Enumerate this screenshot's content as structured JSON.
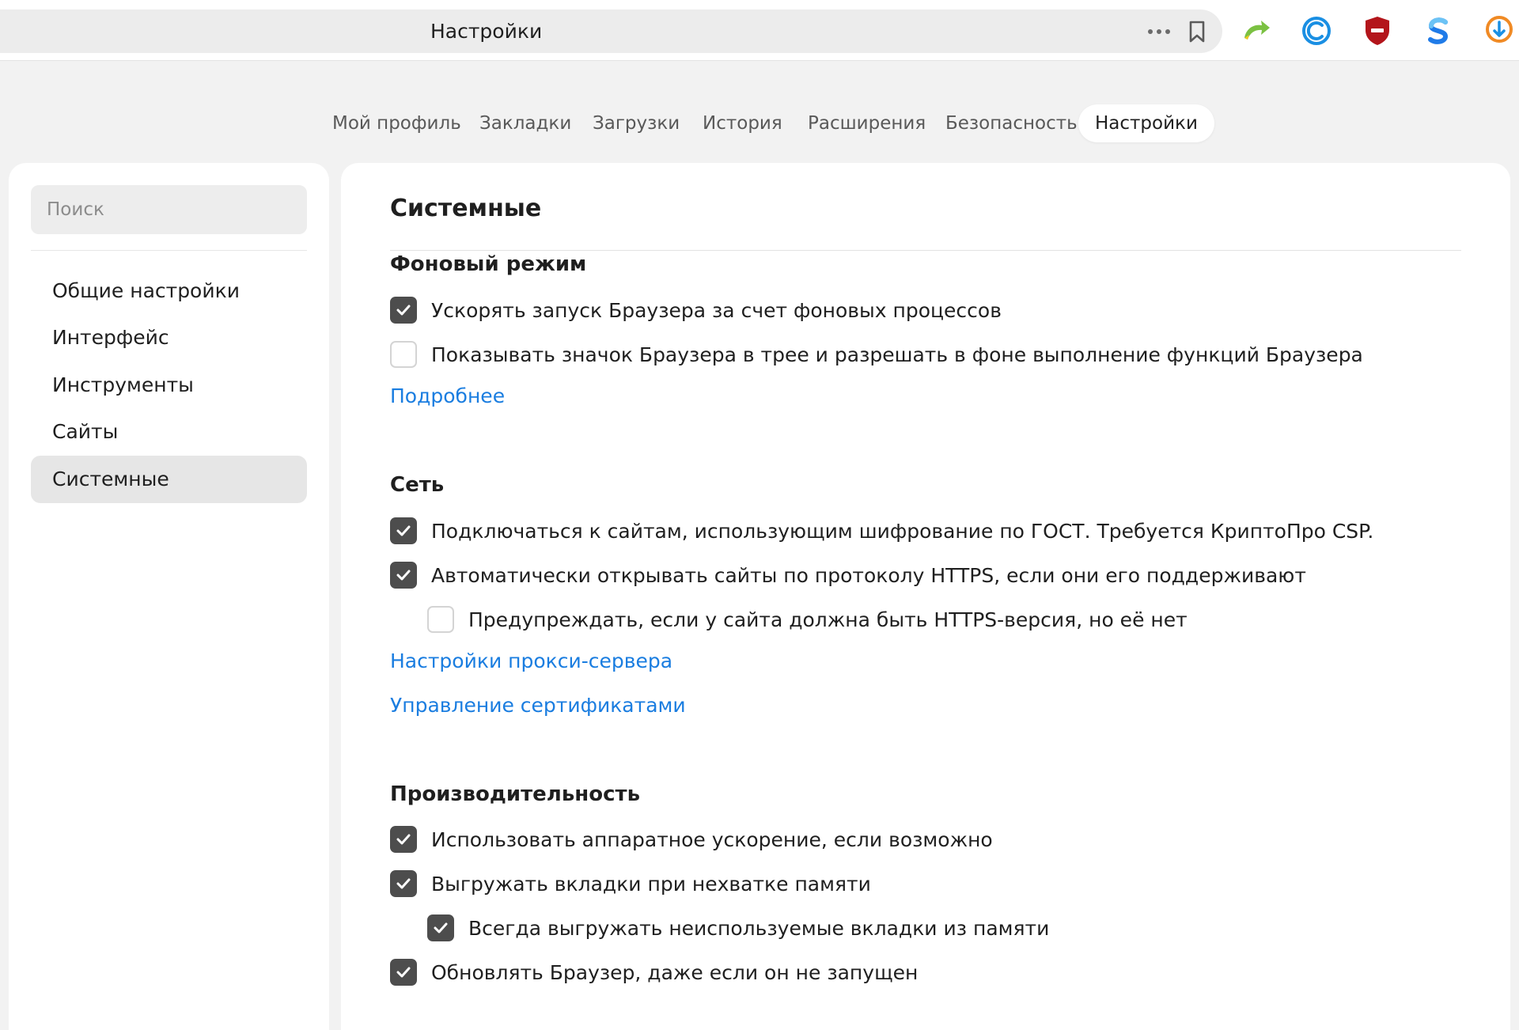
{
  "topbar": {
    "title": "Настройки",
    "extensions": [
      {
        "name": "green-arrow-extension-icon",
        "color": "#7bc142"
      },
      {
        "name": "c-extension-icon",
        "color": "#1a8fe3"
      },
      {
        "name": "shield-extension-icon",
        "color": "#b3151b"
      },
      {
        "name": "s-extension-icon",
        "color": "#1f7be8"
      },
      {
        "name": "orange-extension-icon",
        "color": "#f08a24"
      }
    ]
  },
  "tabs": [
    {
      "label": "Мой профиль",
      "active": false
    },
    {
      "label": "Закладки",
      "active": false
    },
    {
      "label": "Загрузки",
      "active": false
    },
    {
      "label": "История",
      "active": false
    },
    {
      "label": "Расширения",
      "active": false
    },
    {
      "label": "Безопасность",
      "active": false
    },
    {
      "label": "Настройки",
      "active": true
    }
  ],
  "sidebar": {
    "search_placeholder": "Поиск",
    "items": [
      {
        "label": "Общие настройки",
        "active": false
      },
      {
        "label": "Интерфейс",
        "active": false
      },
      {
        "label": "Инструменты",
        "active": false
      },
      {
        "label": "Сайты",
        "active": false
      },
      {
        "label": "Системные",
        "active": true
      }
    ]
  },
  "main": {
    "title": "Системные",
    "sections": {
      "background": {
        "title": "Фоновый режим",
        "options": [
          {
            "label": "Ускорять запуск Браузера за счет фоновых процессов",
            "checked": true
          },
          {
            "label": "Показывать значок Браузера в трее и разрешать в фоне выполнение функций Браузера",
            "checked": false
          }
        ],
        "link": "Подробнее"
      },
      "network": {
        "title": "Сеть",
        "options": [
          {
            "label": "Подключаться к сайтам, использующим шифрование по ГОСТ. Требуется КриптоПро CSP.",
            "checked": true
          },
          {
            "label": "Автоматически открывать сайты по протоколу HTTPS, если они его поддерживают",
            "checked": true
          },
          {
            "label": "Предупреждать, если у сайта должна быть HTTPS-версия, но её нет",
            "checked": false
          }
        ],
        "links": [
          "Настройки прокси-сервера",
          "Управление сертификатами"
        ]
      },
      "performance": {
        "title": "Производительность",
        "options": [
          {
            "label": "Использовать аппаратное ускорение, если возможно",
            "checked": true
          },
          {
            "label": "Выгружать вкладки при нехватке памяти",
            "checked": true
          },
          {
            "label": "Всегда выгружать неиспользуемые вкладки из памяти",
            "checked": true
          },
          {
            "label": "Обновлять Браузер, даже если он не запущен",
            "checked": true
          }
        ]
      }
    }
  }
}
